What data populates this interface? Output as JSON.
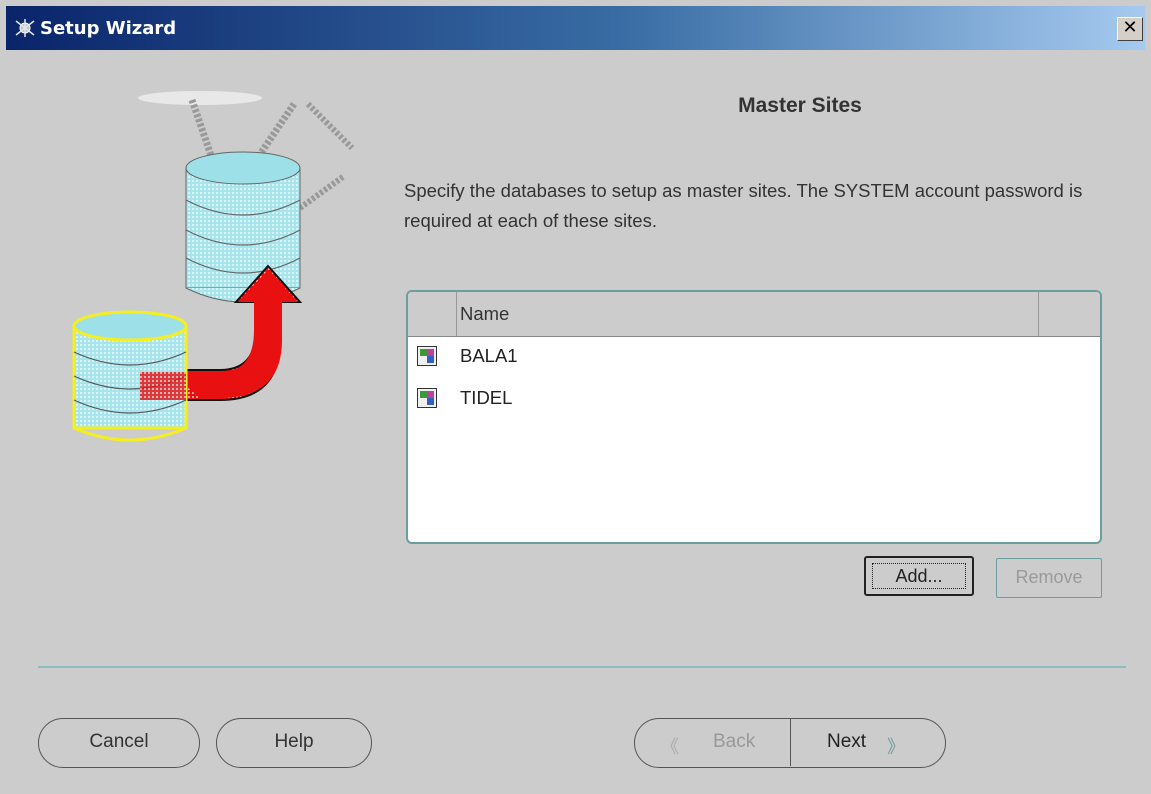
{
  "window": {
    "title": "Setup Wizard",
    "close_label": "✕"
  },
  "page": {
    "heading": "Master Sites",
    "description": "Specify the databases to setup as master sites. The SYSTEM account password is required at each of these sites."
  },
  "table": {
    "columns": [
      "Name"
    ],
    "rows": [
      {
        "name": "BALA1"
      },
      {
        "name": "TIDEL"
      }
    ]
  },
  "actions": {
    "add_label": "Add...",
    "remove_label": "Remove"
  },
  "footer": {
    "cancel_label": "Cancel",
    "help_label": "Help",
    "back_label": "Back",
    "next_label": "Next",
    "back_chevron": "《",
    "next_chevron": "》"
  },
  "icons": {
    "title_icon": "wizard-icon",
    "row_icon": "database-site-icon",
    "illustration": "master-sites-replication-illustration"
  },
  "colors": {
    "title_bar_start": "#0a246a",
    "title_bar_end": "#a6caf0",
    "accent_teal": "#6b9e9e",
    "arrow_red": "#e81010",
    "database_cyan": "#9ee0e8",
    "highlight_yellow": "#f5ef20"
  }
}
